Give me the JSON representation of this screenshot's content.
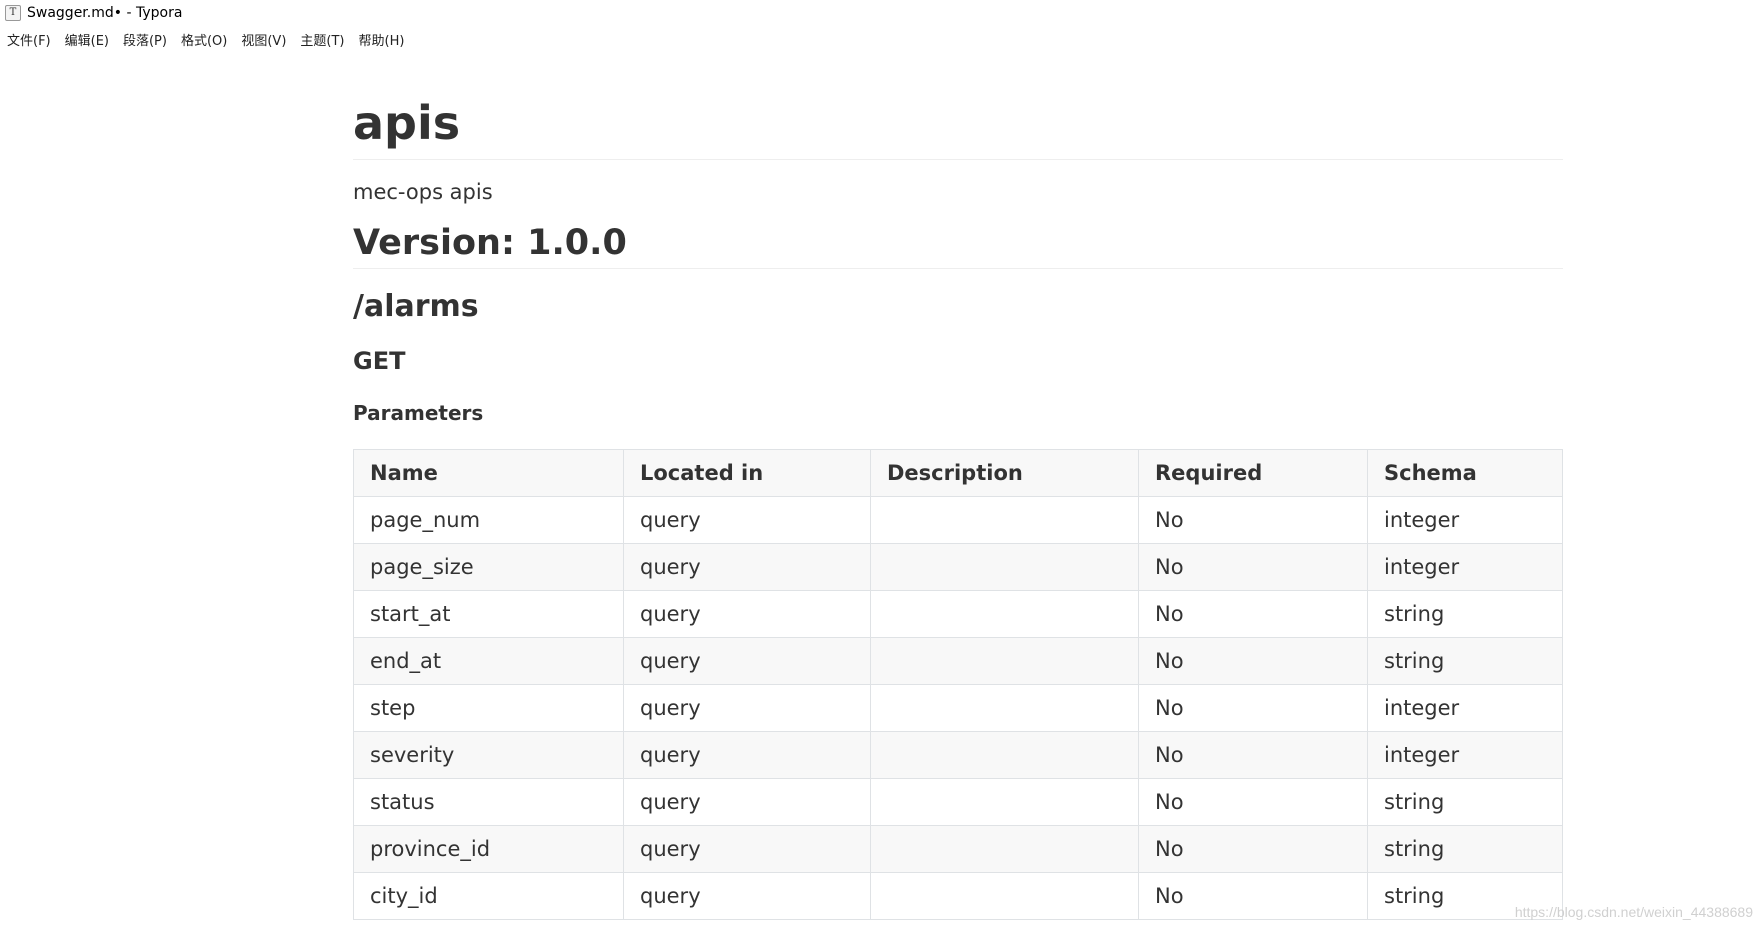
{
  "window": {
    "icon_glyph": "T",
    "title": "Swagger.md• - Typora"
  },
  "menu": [
    {
      "label": "文件(F)"
    },
    {
      "label": "编辑(E)"
    },
    {
      "label": "段落(P)"
    },
    {
      "label": "格式(O)"
    },
    {
      "label": "视图(V)"
    },
    {
      "label": "主题(T)"
    },
    {
      "label": "帮助(H)"
    }
  ],
  "document": {
    "title": "apis",
    "description": "mec-ops apis",
    "version_heading": "Version: 1.0.0",
    "path_heading": "/alarms",
    "method_heading": "GET",
    "parameters_heading": "Parameters"
  },
  "table": {
    "headers": [
      "Name",
      "Located in",
      "Description",
      "Required",
      "Schema"
    ],
    "rows": [
      [
        "page_num",
        "query",
        "",
        "No",
        "integer"
      ],
      [
        "page_size",
        "query",
        "",
        "No",
        "integer"
      ],
      [
        "start_at",
        "query",
        "",
        "No",
        "string"
      ],
      [
        "end_at",
        "query",
        "",
        "No",
        "string"
      ],
      [
        "step",
        "query",
        "",
        "No",
        "integer"
      ],
      [
        "severity",
        "query",
        "",
        "No",
        "integer"
      ],
      [
        "status",
        "query",
        "",
        "No",
        "string"
      ],
      [
        "province_id",
        "query",
        "",
        "No",
        "string"
      ],
      [
        "city_id",
        "query",
        "",
        "No",
        "string"
      ]
    ]
  },
  "watermark": "https://blog.csdn.net/weixin_44388689"
}
